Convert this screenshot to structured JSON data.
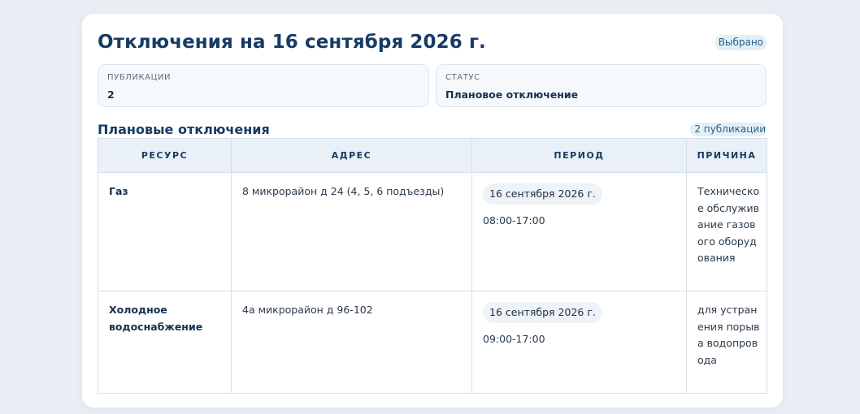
{
  "header": {
    "title": "Отключения на 16 сентября 2026 г.",
    "selected_chip": "Выбрано"
  },
  "stats": [
    {
      "label": "ПУБЛИКАЦИИ",
      "value": "2"
    },
    {
      "label": "СТАТУС",
      "value": "Плановое отключение"
    }
  ],
  "section": {
    "title": "Плановые отключения",
    "count_chip": "2 публикации"
  },
  "table": {
    "columns": [
      "РЕСУРС",
      "АДРЕС",
      "ПЕРИОД",
      "ПРИЧИНА"
    ],
    "rows": [
      {
        "resource": "Газ",
        "address": "8 микрорайон д 24 (4, 5, 6 подъезды)",
        "date": "16 сентября 2026 г.",
        "time": "08:00-17:00",
        "reason": "Техническое обслуживание газового оборудования"
      },
      {
        "resource": "Холодное водоснабжение",
        "address": "4а микрорайон д 96-102",
        "date": "16 сентября 2026 г.",
        "time": "09:00-17:00",
        "reason": "для устранения порыва водопровода"
      }
    ]
  }
}
